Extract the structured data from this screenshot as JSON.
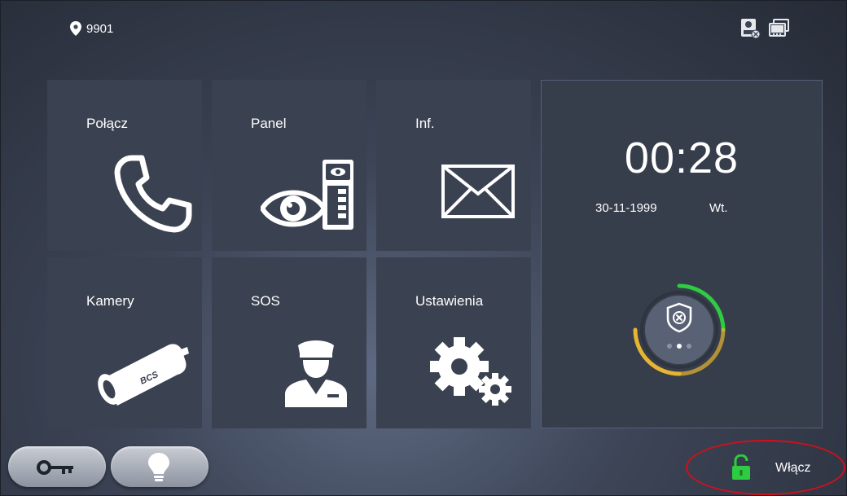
{
  "header": {
    "location_number": "9901"
  },
  "tiles": [
    {
      "label": "Połącz",
      "icon": "phone-icon"
    },
    {
      "label": "Panel",
      "icon": "eye-panel-icon"
    },
    {
      "label": "Inf.",
      "icon": "envelope-icon"
    },
    {
      "label": "Kamery",
      "icon": "camera-icon",
      "camera_brand": "BCS"
    },
    {
      "label": "SOS",
      "icon": "guard-icon"
    },
    {
      "label": "Ustawienia",
      "icon": "gears-icon"
    }
  ],
  "clock": {
    "hours": "00",
    "separator": ":",
    "minutes": "28",
    "date": "30-11-1999",
    "weekday": "Wt."
  },
  "arm": {
    "icon": "shield-x-icon",
    "page_indicator_count": 3,
    "active_page": 2
  },
  "bottom": {
    "key_button_icon": "key-icon",
    "light_button_icon": "bulb-icon",
    "unlock_label": "Włącz",
    "unlock_icon": "open-padlock-icon"
  },
  "colors": {
    "accent_green": "#2ecc40",
    "accent_yellow": "#e8b531",
    "highlight_red": "#d0101c"
  }
}
